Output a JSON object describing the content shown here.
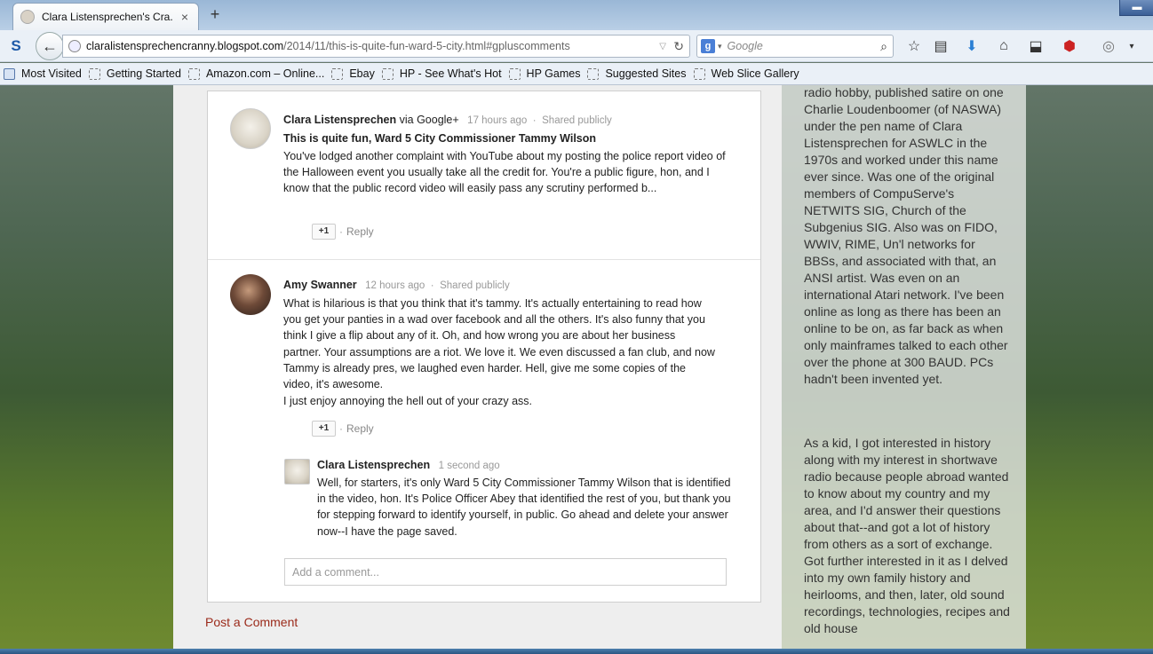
{
  "browser": {
    "tab_title": "Clara Listensprechen's Cra...",
    "new_tab": "+",
    "tab_close": "×",
    "url_host": "claralistensprechencranny.blogspot.com",
    "url_path": "/2014/11/this-is-quite-fun-ward-5-city.html#gpluscomments",
    "search_placeholder": "Google",
    "search_engine": "g"
  },
  "bookmarks": [
    {
      "label": "Most Visited"
    },
    {
      "label": "Getting Started"
    },
    {
      "label": "Amazon.com – Online..."
    },
    {
      "label": "Ebay"
    },
    {
      "label": "HP - See What's Hot"
    },
    {
      "label": "HP Games"
    },
    {
      "label": "Suggested Sites"
    },
    {
      "label": "Web Slice Gallery"
    }
  ],
  "comments": [
    {
      "author": "Clara Listensprechen",
      "via": "via Google+",
      "time": "17 hours ago",
      "visibility": "Shared publicly",
      "title": "This is quite fun, Ward 5 City Commissioner Tammy Wilson",
      "body": "You've lodged another complaint with YouTube about my posting the police report video of the Halloween event you usually take all the credit for.  You're a public figure, hon, and I know that the public record video will easily pass any scrutiny performed b...",
      "plus": "+1",
      "reply": "Reply"
    },
    {
      "author": "Amy Swanner",
      "time": "12 hours ago",
      "visibility": "Shared publicly",
      "body": "What is hilarious is that you think that it's tammy. It's actually entertaining to read how you get your panties in a wad over facebook and all the others. It's also funny that you think I give a flip about any of it. Oh, and how wrong you are about her business partner. Your assumptions are a riot. We love it. We even discussed a fan club, and now Tammy is already pres, we laughed even harder. Hell, give me some copies of the video, it's awesome.",
      "body2": "I just enjoy annoying the hell out of your crazy ass.",
      "plus": "+1",
      "reply": "Reply"
    },
    {
      "author": "Clara Listensprechen",
      "time": "1 second ago",
      "body": "Well, for starters, it's only Ward 5 City Commissioner Tammy Wilson that is identified in the video, hon. It's Police Officer Abey that identified the rest of you, but thank you for stepping forward to identify yourself, in public.  Go ahead and delete your answer now--I have the page saved."
    }
  ],
  "add_comment_placeholder": "Add a comment...",
  "post_comment_link": "Post a Comment",
  "sidebar": {
    "para1": "radio hobby,  published satire on one Charlie Loudenboomer (of NASWA) under the pen name of Clara Listensprechen for ASWLC in the 1970s and worked under this name ever since. Was one of the original members of CompuServe's NETWITS SIG, Church of the Subgenius SIG. Also was on FIDO, WWIV, RIME, Un'l networks for BBSs, and associated with that, an ANSI artist. Was even on an international Atari network. I've been online as long as there has been an online to be on, as far back as when only mainframes talked to each other over the phone at 300 BAUD. PCs hadn't been invented yet.",
    "para2": "As a kid, I got interested in history along with my interest in shortwave radio because people abroad wanted to know about my country and my area, and I'd answer their questions about that--and got a lot of history from others as a sort of exchange. Got further interested in it as I delved into my own family history and heirlooms, and then, later, old sound recordings, technologies, recipes and old house"
  }
}
